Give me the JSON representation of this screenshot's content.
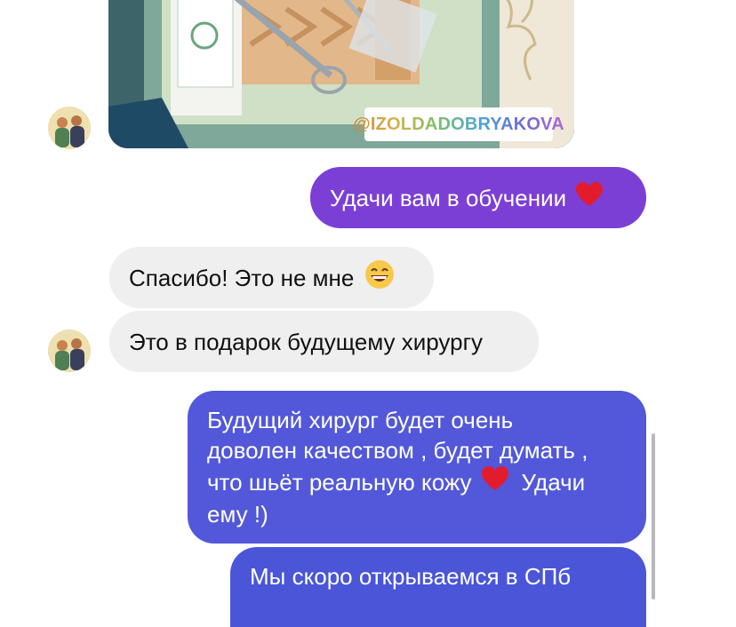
{
  "photo": {
    "watermark": "@IZOLDADOBRYAKOVA"
  },
  "messages": [
    {
      "dir": "out",
      "text": "Удачи вам в обучении",
      "emoji": "heart-icon"
    },
    {
      "dir": "in",
      "text": "Спасибо! Это не мне",
      "emoji": "smile-icon"
    },
    {
      "dir": "in",
      "text": "Это в подарок будущему хирургу"
    },
    {
      "dir": "out",
      "lines": [
        "Будущий хирург будет очень",
        "доволен качеством , будет думать ,",
        "что шьёт реальную кожу",
        "Удачи",
        "ему !)"
      ]
    },
    {
      "dir": "out",
      "text": "Мы скоро открываемся в СПб"
    }
  ],
  "colors": {
    "incoming": "#efeff0",
    "outgoing_purple": "#7b3fd6",
    "outgoing_blue": "#4a55d8",
    "heart": "#e21c2d"
  }
}
